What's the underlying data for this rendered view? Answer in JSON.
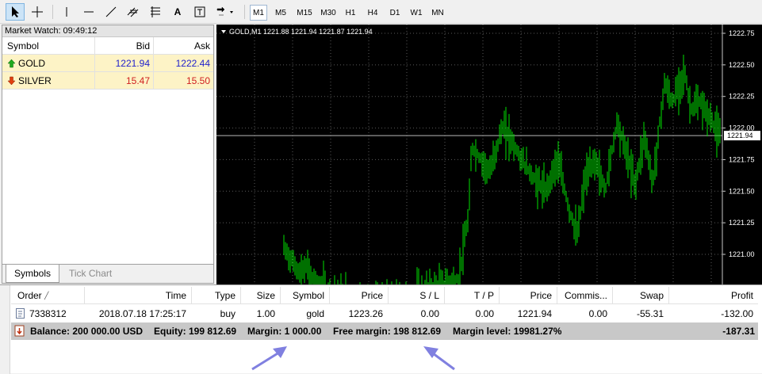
{
  "toolbar": {
    "timeframes": [
      "M1",
      "M5",
      "M15",
      "M30",
      "H1",
      "H4",
      "D1",
      "W1",
      "MN"
    ],
    "active_timeframe": "M1"
  },
  "market_watch": {
    "title": "Market Watch: 09:49:12",
    "columns": [
      "Symbol",
      "Bid",
      "Ask"
    ],
    "rows": [
      {
        "symbol": "GOLD",
        "bid": "1221.94",
        "ask": "1222.44",
        "direction": "up"
      },
      {
        "symbol": "SILVER",
        "bid": "15.47",
        "ask": "15.50",
        "direction": "down"
      }
    ],
    "tabs": [
      "Symbols",
      "Tick Chart"
    ]
  },
  "chart": {
    "header": "GOLD,M1  1221.88 1221.94 1221.87 1221.94",
    "price_labels": [
      "1222.75",
      "1222.50",
      "1222.25",
      "1222.00",
      "1221.75",
      "1221.50",
      "1221.25",
      "1221.00"
    ],
    "current_price": "1221.94",
    "colors": {
      "background": "#000000",
      "candles": "#00e000",
      "grid": "#5a5a5a",
      "axis_text": "#ffffff"
    }
  },
  "terminal": {
    "columns": [
      "Order",
      "Time",
      "Type",
      "Size",
      "Symbol",
      "Price",
      "S / L",
      "T / P",
      "Price",
      "Commis...",
      "Swap",
      "Profit"
    ],
    "order": {
      "order": "7338312",
      "time": "2018.07.18 17:25:17",
      "type": "buy",
      "size": "1.00",
      "symbol": "gold",
      "price": "1223.26",
      "sl": "0.00",
      "tp": "0.00",
      "current_price": "1221.94",
      "commission": "0.00",
      "swap": "-55.31",
      "profit": "-132.00"
    },
    "balance_line": {
      "balance": "Balance: 200 000.00 USD",
      "equity": "Equity: 199 812.69",
      "margin": "Margin: 1 000.00",
      "free_margin": "Free margin: 198 812.69",
      "margin_level": "Margin level: 19981.27%",
      "total": "-187.31"
    }
  },
  "annotation_color": "#8080e0"
}
